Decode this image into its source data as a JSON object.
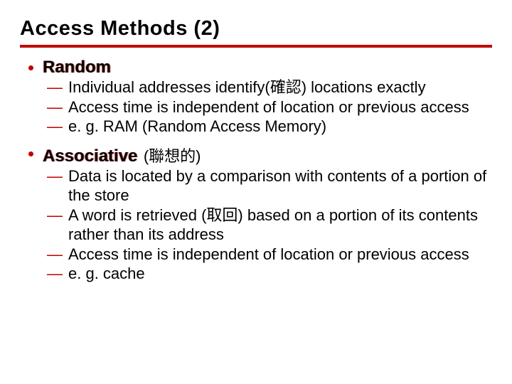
{
  "title": "Access Methods (2)",
  "bullets": [
    {
      "heading": "Random",
      "annotation": "",
      "items": [
        "Individual addresses identify(確認) locations exactly",
        "Access time is independent of location or previous access",
        "e. g. RAM (Random Access Memory)"
      ]
    },
    {
      "heading": "Associative",
      "annotation": "(聯想的)",
      "items": [
        "Data is located by a comparison with contents of a portion of the store",
        "A word is retrieved (取回) based on a portion of its contents rather than its address",
        "Access time is independent of location or previous access",
        "e. g. cache"
      ]
    }
  ]
}
